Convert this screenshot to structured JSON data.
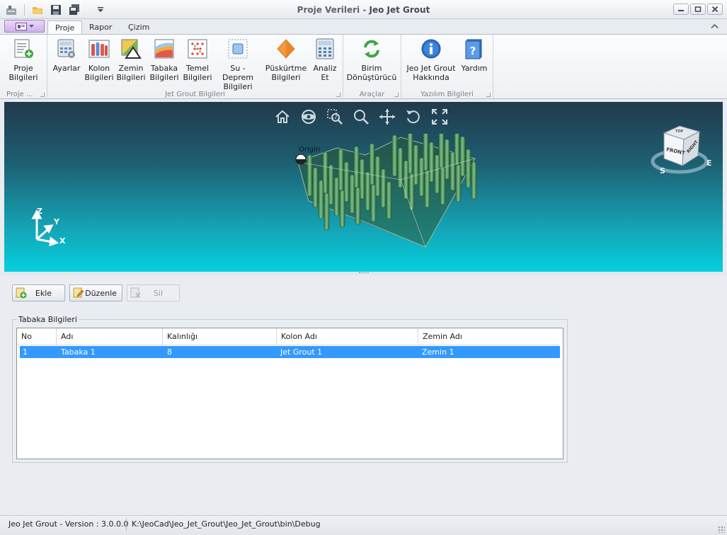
{
  "window": {
    "title_doc": "Proje Verileri",
    "title_sep": " - ",
    "title_app": "Jeo Jet Grout"
  },
  "qat": [
    "app-icon",
    "open-folder-icon",
    "save-icon",
    "save-all-icon",
    "qat-dropdown-icon"
  ],
  "tabs": [
    {
      "label": "Proje"
    },
    {
      "label": "Rapor"
    },
    {
      "label": "Çizim"
    }
  ],
  "ribbon": {
    "groups": [
      {
        "label": "Proje ...",
        "buttons": [
          {
            "label": "Proje\nBilgileri",
            "icon": "project-info-icon"
          }
        ]
      },
      {
        "label": "Jet Grout Bilgileri",
        "buttons": [
          {
            "label": "Ayarlar",
            "icon": "settings-calculator-icon"
          },
          {
            "label": "Kolon\nBilgileri",
            "icon": "column-info-icon"
          },
          {
            "label": "Zemin\nBilgileri",
            "icon": "soil-info-icon"
          },
          {
            "label": "Tabaka\nBilgileri",
            "icon": "layer-info-icon"
          },
          {
            "label": "Temel\nBilgileri",
            "icon": "foundation-info-icon"
          },
          {
            "label": "Su - Deprem\nBilgileri",
            "icon": "water-earthquake-icon"
          },
          {
            "label": "Püskürtme\nBilgileri",
            "icon": "spray-info-icon"
          },
          {
            "label": "Analiz\nEt",
            "icon": "analyze-icon"
          }
        ]
      },
      {
        "label": "Araçlar",
        "buttons": [
          {
            "label": "Birim\nDönüştürücü",
            "icon": "unit-converter-icon"
          }
        ]
      },
      {
        "label": "Yazılım Bilgileri",
        "buttons": [
          {
            "label": "Jeo Jet Grout\nHakkında",
            "icon": "about-icon"
          },
          {
            "label": "Yardım",
            "icon": "help-icon"
          }
        ]
      }
    ]
  },
  "viewport": {
    "origin_label": "Origin",
    "axis_labels": {
      "x": "X",
      "y": "Y",
      "z": "Z"
    },
    "viewcube": {
      "front": "FRONT",
      "right": "RIGHT",
      "top": "TOP",
      "compass_s": "S",
      "compass_e": "E"
    }
  },
  "actions": {
    "add": "Ekle",
    "edit": "Düzenle",
    "delete": "Sil"
  },
  "layers_group": {
    "title": "Tabaka Bilgileri",
    "columns": [
      "No",
      "Adı",
      "Kalınlığı",
      "Kolon Adı",
      "Zemin Adı"
    ],
    "rows": [
      [
        "1",
        "Tabaka 1",
        "8",
        "Jet Grout 1",
        "Zemin 1"
      ]
    ]
  },
  "status": {
    "version": "Jeo Jet Grout - Version : 3.0.0.0",
    "path": "K:\\JeoCad\\Jeo_Jet_Grout\\Jeo_Jet_Grout\\bin\\Debug"
  },
  "colors": {
    "selection": "#3399ff",
    "viewport_top": "#213a4c",
    "viewport_bottom": "#05d0de",
    "appmenu": "#cdb2e8"
  }
}
